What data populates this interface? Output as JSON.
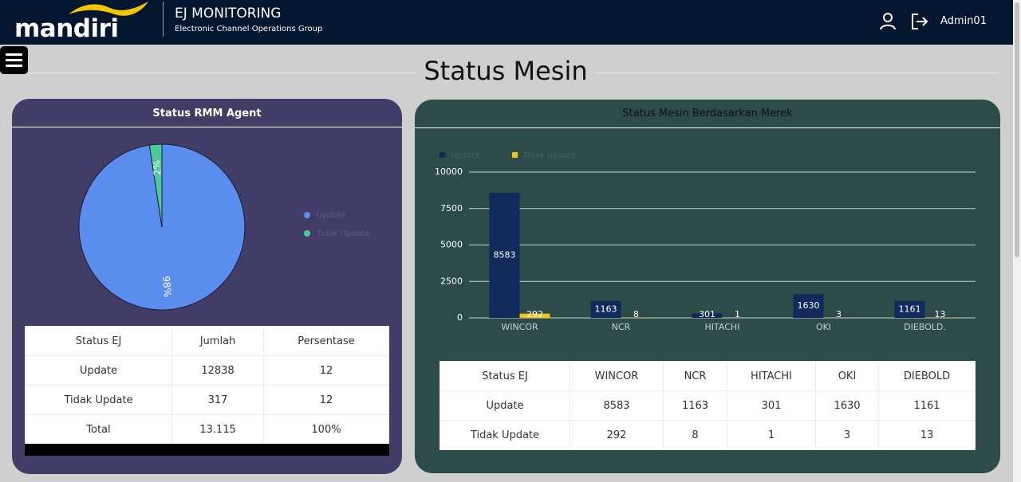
{
  "header": {
    "logo_text": "mandiri",
    "app_title": "EJ MONITORING",
    "app_subtitle": "Electronic Channel Operations Group",
    "username": "Admin01",
    "user_icon": "user-icon",
    "logout_icon": "logout-icon"
  },
  "menu_icon": "hamburger-icon",
  "page_title": "Status Mesin",
  "left_card": {
    "title": "Status RMM Agent",
    "pie_labels": [
      "98%",
      "2%"
    ],
    "legend": [
      {
        "label": "Update",
        "color": "#5b8def"
      },
      {
        "label": "Tidak Update",
        "color": "#4cc99a"
      }
    ],
    "table": {
      "headers": [
        "Status EJ",
        "Jumlah",
        "Persentase"
      ],
      "rows": [
        [
          "Update",
          "12838",
          "12"
        ],
        [
          "Tidak Update",
          "317",
          "12"
        ],
        [
          "Total",
          "13.115",
          "100%"
        ]
      ]
    }
  },
  "right_card": {
    "title": "Status Mesin Berdasarkan Merek",
    "table": {
      "headers": [
        "Status EJ",
        "WINCOR",
        "NCR",
        "HITACHI",
        "OKI",
        "DIEBOLD"
      ],
      "rows": [
        [
          "Update",
          "8583",
          "1163",
          "301",
          "1630",
          "1161"
        ],
        [
          "Tidak Update",
          "292",
          "8",
          "1",
          "3",
          "13"
        ]
      ]
    }
  },
  "chart_data": [
    {
      "type": "pie",
      "labels": [
        "Update",
        "Tidak Update"
      ],
      "values": [
        12838,
        317
      ],
      "slice_labels": [
        "98%",
        "2%"
      ],
      "colors": [
        "#5b8def",
        "#4cc99a"
      ],
      "legend_position": "right"
    },
    {
      "type": "bar",
      "categories": [
        "WINCOR",
        "NCR",
        "HITACHI",
        "OKI",
        "DIEBOLD."
      ],
      "series": [
        {
          "name": "Update",
          "values": [
            8583,
            1163,
            301,
            1630,
            1161
          ],
          "color": "#112a5c"
        },
        {
          "name": "Tidak Update",
          "values": [
            292,
            8,
            1,
            3,
            13
          ],
          "color": "#f2c418"
        }
      ],
      "y_ticks": [
        0,
        2500,
        5000,
        7500,
        10000
      ],
      "ylim": [
        0,
        10000
      ],
      "grid": true,
      "legend_position": "top-left"
    }
  ]
}
